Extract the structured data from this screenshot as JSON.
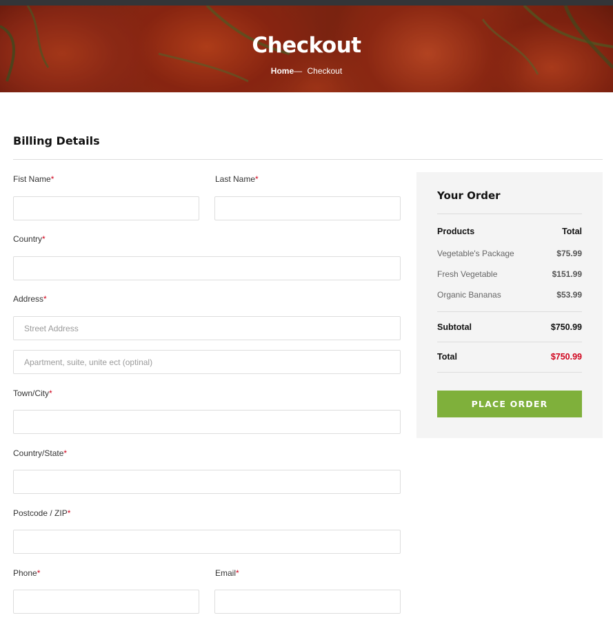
{
  "hero": {
    "title": "Checkout",
    "breadcrumb": {
      "home": "Home",
      "separator": "—",
      "current": "Checkout"
    }
  },
  "billing": {
    "title": "Billing Details",
    "required_mark": "*",
    "fields": {
      "first_name": {
        "label": "Fist Name",
        "value": "",
        "placeholder": ""
      },
      "last_name": {
        "label": "Last Name",
        "value": "",
        "placeholder": ""
      },
      "country": {
        "label": "Country",
        "value": "",
        "placeholder": ""
      },
      "address": {
        "label": "Address",
        "street_placeholder": "Street Address",
        "apartment_placeholder": "Apartment, suite, unite ect (optinal)",
        "street_value": "",
        "apartment_value": ""
      },
      "town_city": {
        "label": "Town/City",
        "value": "",
        "placeholder": ""
      },
      "country_state": {
        "label": "Country/State",
        "value": "",
        "placeholder": ""
      },
      "postcode": {
        "label": "Postcode / ZIP",
        "value": "",
        "placeholder": ""
      },
      "phone": {
        "label": "Phone",
        "value": "",
        "placeholder": ""
      },
      "email": {
        "label": "Email",
        "value": "",
        "placeholder": ""
      }
    }
  },
  "order": {
    "title": "Your Order",
    "header": {
      "products": "Products",
      "total": "Total"
    },
    "items": [
      {
        "name": "Vegetable's Package",
        "price": "$75.99"
      },
      {
        "name": "Fresh Vegetable",
        "price": "$151.99"
      },
      {
        "name": "Organic Bananas",
        "price": "$53.99"
      }
    ],
    "subtotal": {
      "label": "Subtotal",
      "value": "$750.99"
    },
    "total": {
      "label": "Total",
      "value": "$750.99"
    },
    "place_order_label": "PLACE ORDER"
  },
  "colors": {
    "accent_green": "#7fb03b",
    "required_red": "#d0021b",
    "total_red": "#d0021b",
    "order_box_bg": "#f4f4f4",
    "top_bar": "#333538"
  }
}
